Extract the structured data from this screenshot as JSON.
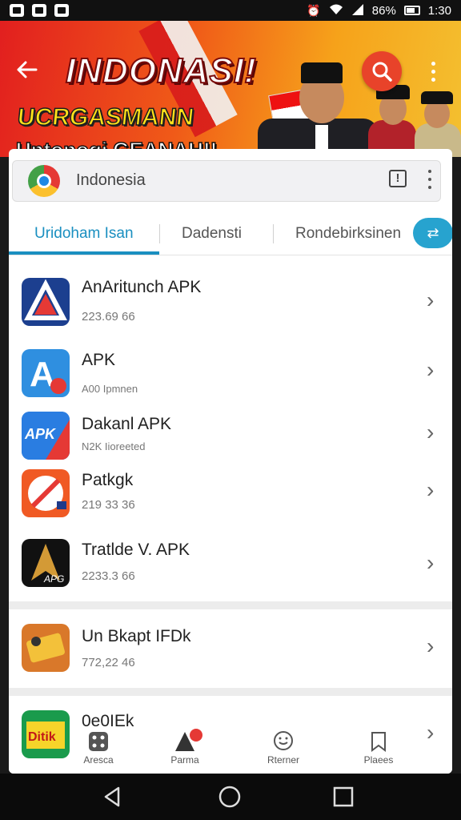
{
  "status_bar": {
    "battery": "86%",
    "time": "1:30"
  },
  "banner": {
    "title": "INDONASI!",
    "subtitle_1": "UCRGASMANN",
    "subtitle_2": "Untonogi GEANAH!!"
  },
  "address_bar": {
    "text": "Indonesia"
  },
  "tabs": [
    {
      "label": "Uridoham Isan",
      "active": true
    },
    {
      "label": "Dadensti",
      "active": false
    },
    {
      "label": "Rondebirksinen",
      "active": false
    }
  ],
  "apps": [
    {
      "title": "AnAritunch APK",
      "subtitle": "223.69 66",
      "icon": "apk-launcher-icon"
    },
    {
      "title": "APK",
      "subtitle": "A00 Ipmnen",
      "icon": "apk-store-icon"
    },
    {
      "title": "Dakanl APK",
      "subtitle": "N2K Iioreeted",
      "icon": "apk-badge-icon"
    },
    {
      "title": "Patkgk",
      "subtitle": "219 33 36",
      "icon": "compass-icon"
    },
    {
      "title": "Tratlde V. APK",
      "subtitle": "2233.3 66",
      "icon": "apg-icon"
    },
    {
      "title": "Un Bkapt IFDk",
      "subtitle": "772,22 46",
      "icon": "ticket-icon"
    },
    {
      "title": "0e0IEk",
      "subtitle": "",
      "icon": "game-icon"
    }
  ],
  "bottom_nav": [
    {
      "label": "Aresca",
      "icon": "dice-icon"
    },
    {
      "label": "Parma",
      "icon": "apps-icon"
    },
    {
      "label": "Rterner",
      "icon": "chat-icon"
    },
    {
      "label": "Plaees",
      "icon": "bookmark-icon"
    }
  ],
  "colors": {
    "accent": "#1a8fc0",
    "banner_red": "#e21f1f",
    "banner_yellow": "#f4c030"
  }
}
